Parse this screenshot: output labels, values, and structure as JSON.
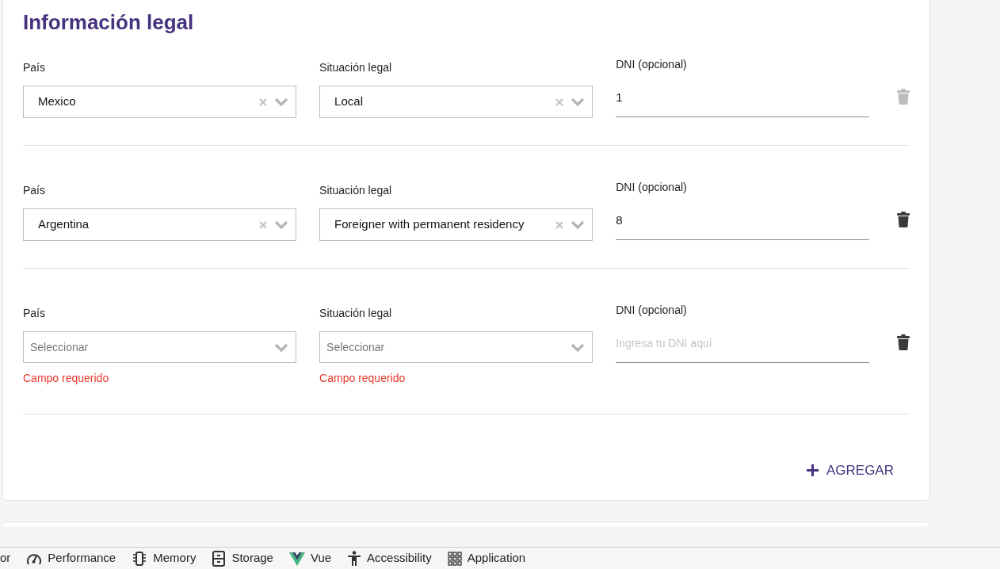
{
  "title": "Información legal",
  "entries": [
    {
      "country": {
        "label": "País",
        "value": "Mexico"
      },
      "status": {
        "label": "Situación legal",
        "value": "Local"
      },
      "dni": {
        "label": "DNI (opcional)",
        "value": "1"
      },
      "delete_disabled": true
    },
    {
      "country": {
        "label": "País",
        "value": "Argentina"
      },
      "status": {
        "label": "Situación legal",
        "value": "Foreigner with permanent residency"
      },
      "dni": {
        "label": "DNI (opcional)",
        "value": "8"
      },
      "delete_disabled": false
    },
    {
      "country": {
        "label": "País",
        "placeholder": "Seleccionar",
        "error": "Campo requerido"
      },
      "status": {
        "label": "Situación legal",
        "placeholder": "Seleccionar",
        "error": "Campo requerido"
      },
      "dni": {
        "label": "DNI (opcional)",
        "placeholder": "Ingresa tu DNI aquí"
      },
      "delete_disabled": false
    }
  ],
  "add_button": "AGREGAR",
  "devtools_tabs": [
    {
      "kind": "cut",
      "label": "or"
    },
    {
      "kind": "performance",
      "label": "Performance"
    },
    {
      "kind": "memory",
      "label": "Memory"
    },
    {
      "kind": "storage",
      "label": "Storage"
    },
    {
      "kind": "vue",
      "label": "Vue"
    },
    {
      "kind": "accessibility",
      "label": "Accessibility"
    },
    {
      "kind": "application",
      "label": "Application"
    }
  ]
}
